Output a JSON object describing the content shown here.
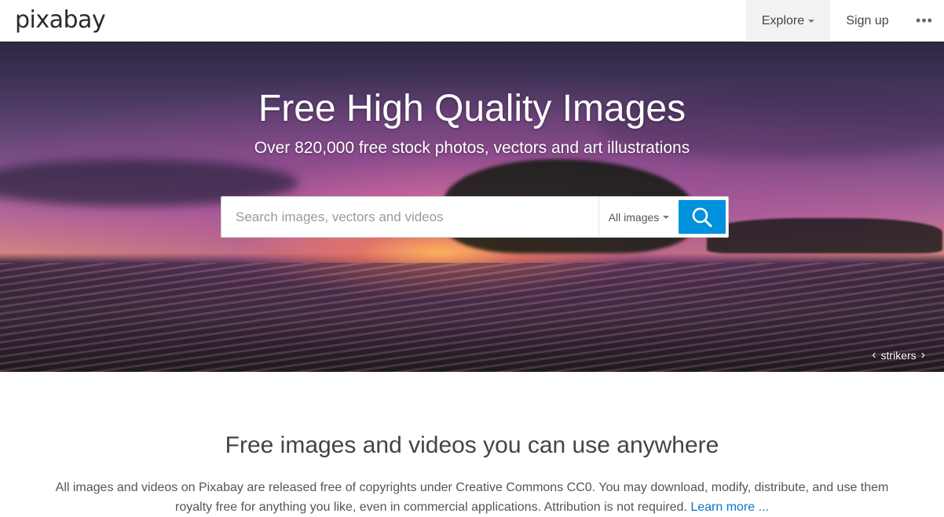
{
  "header": {
    "logo": "pixabay",
    "nav": {
      "explore": "Explore",
      "signup": "Sign up",
      "more": "•••"
    }
  },
  "hero": {
    "title": "Free High Quality Images",
    "subtitle": "Over 820,000 free stock photos, vectors and art illustrations",
    "search": {
      "placeholder": "Search images, vectors and videos",
      "value": "",
      "type_selected": "All images"
    },
    "credit": {
      "prev": "‹",
      "name": "strikers",
      "next": "›"
    }
  },
  "intro": {
    "title": "Free images and videos you can use anywhere",
    "text": "All images and videos on Pixabay are released free of copyrights under Creative Commons CC0. You may download, modify, distribute, and use them royalty free for anything you like, even in commercial applications. Attribution is not required.",
    "learn_more": "Learn more ..."
  },
  "colors": {
    "accent": "#0091dd",
    "link": "#0a74c7"
  },
  "icons": [
    "search-icon",
    "chevron-down-icon",
    "more-icon"
  ]
}
